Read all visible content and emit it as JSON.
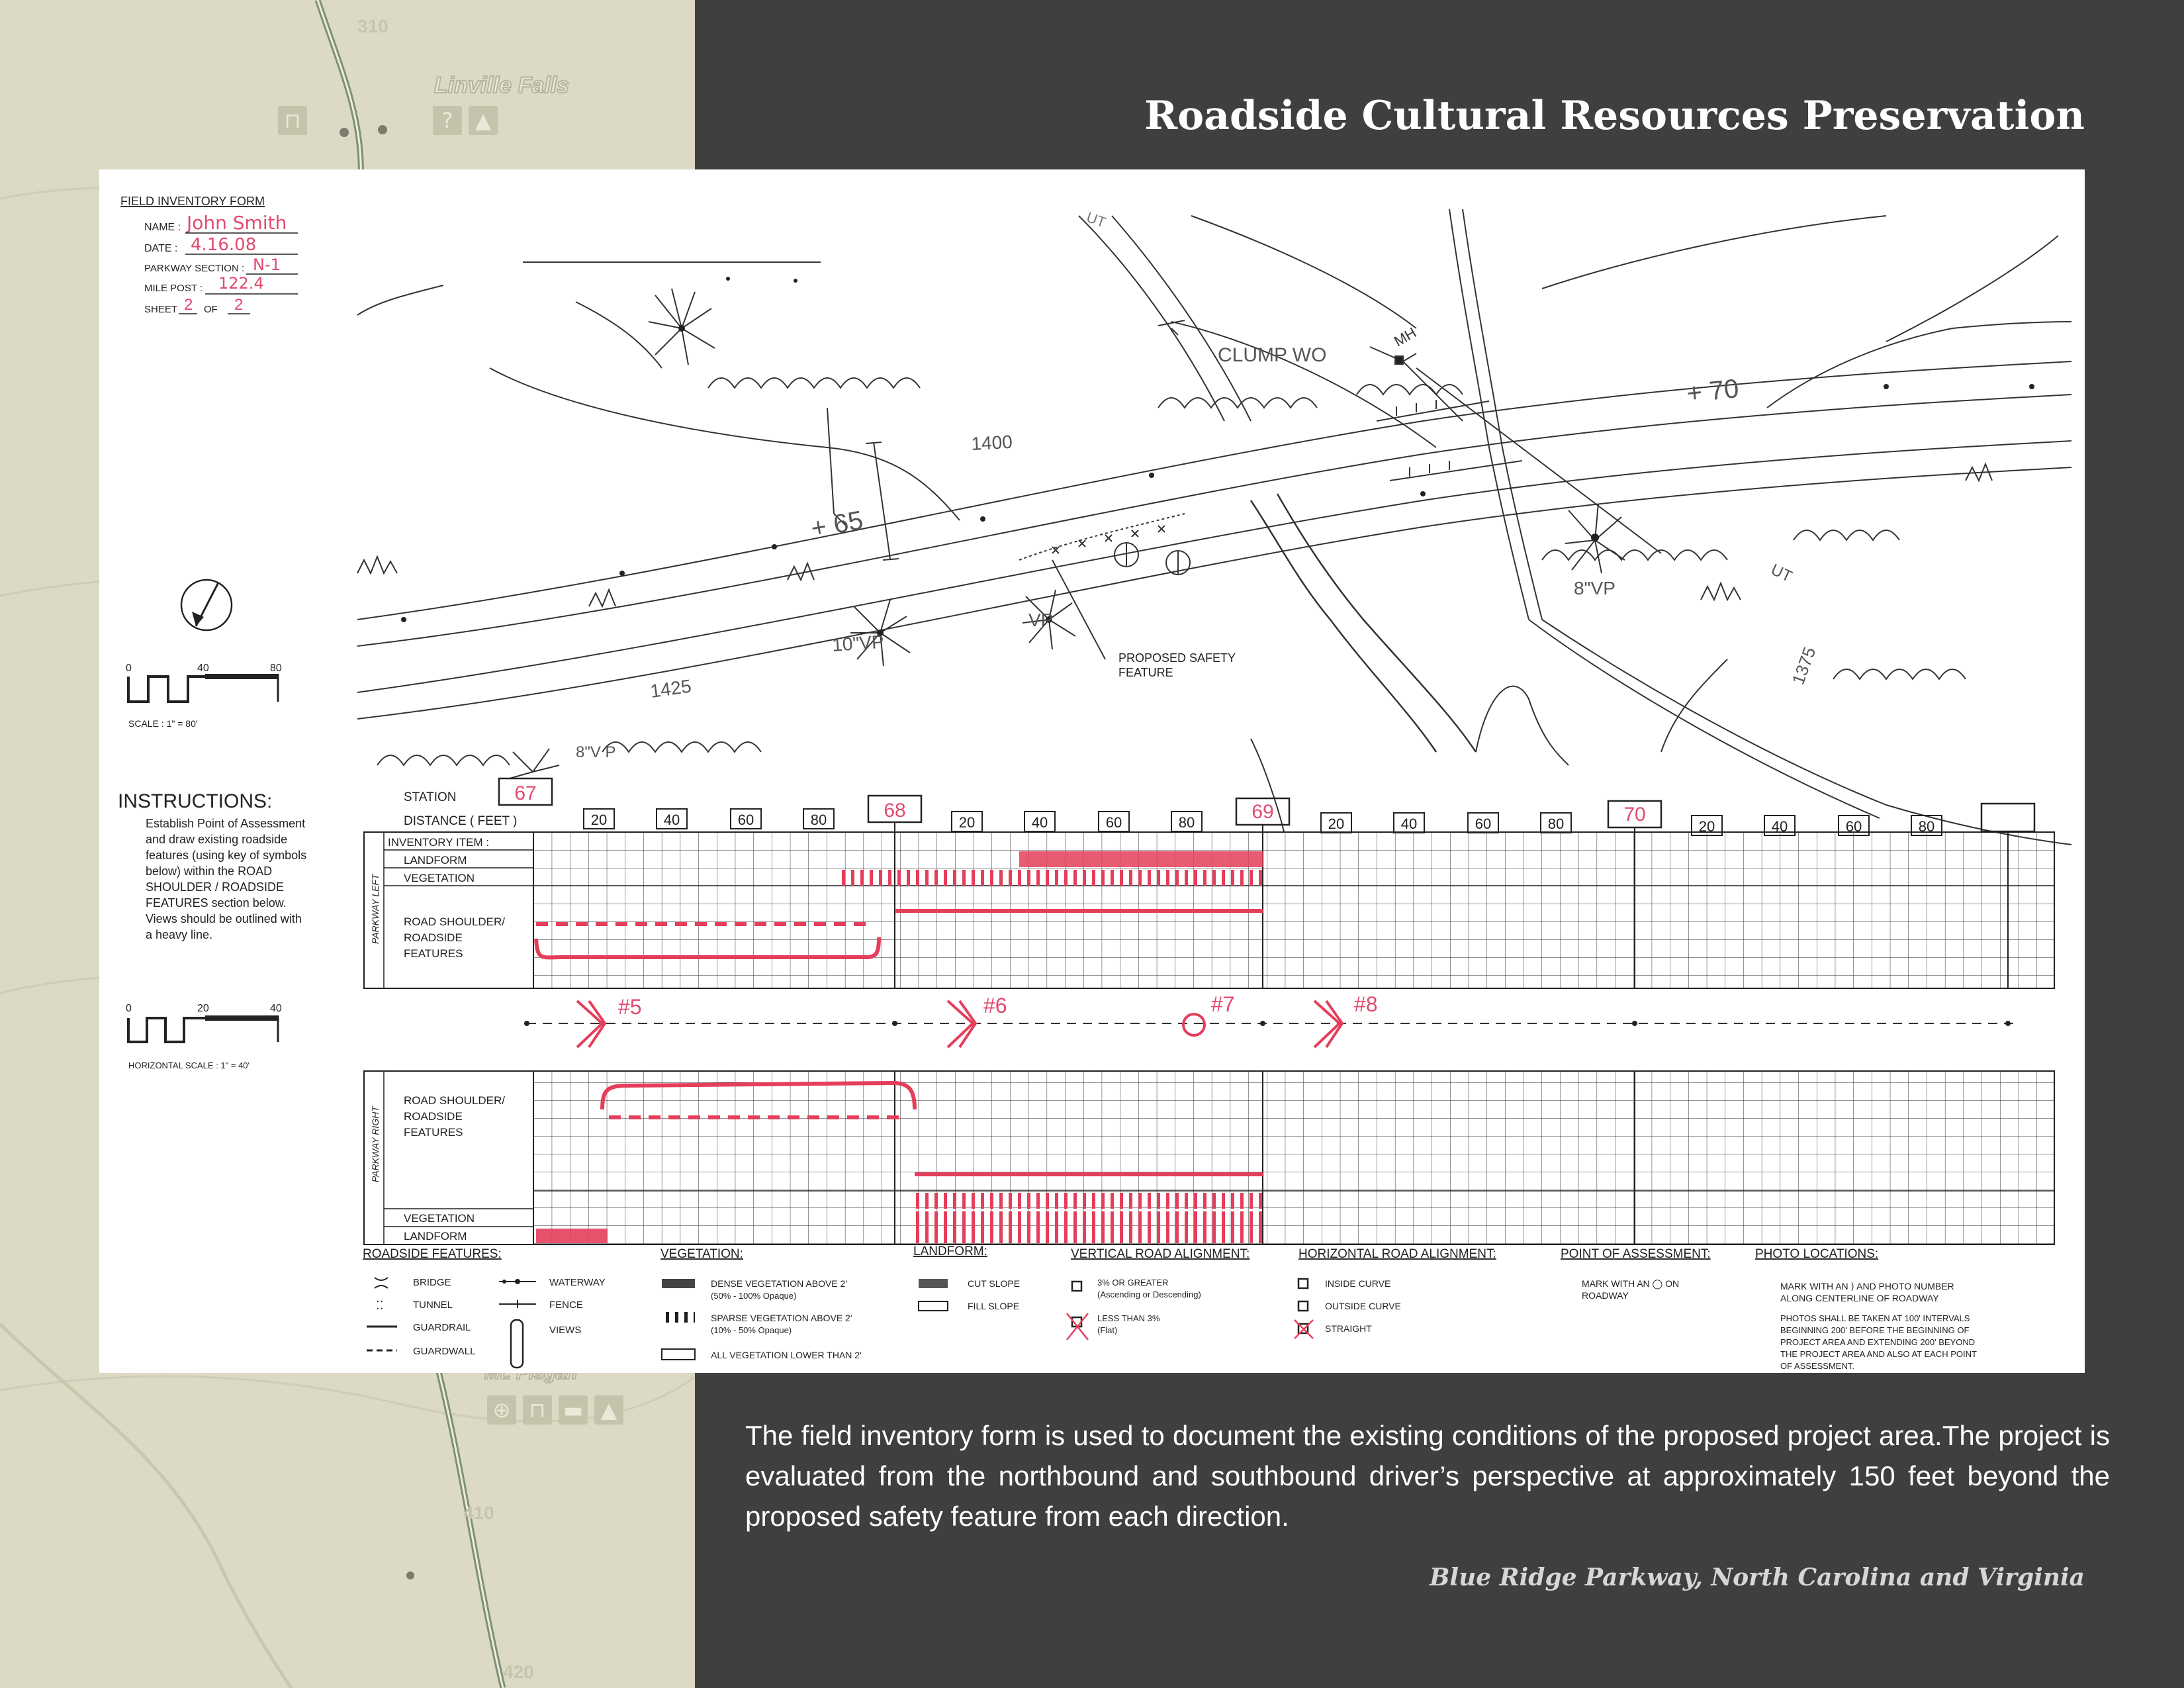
{
  "page_title": "Roadside Cultural Resources Preservation",
  "caption": "The field inventory form is used to document the existing conditions of the proposed project area.The project is evaluated from the northbound and southbound driver’s perspective at approximately 150 feet beyond the proposed safety feature from each direction.",
  "source": "Blue Ridge Parkway, North Carolina and Virginia",
  "map": {
    "route_numbers": [
      "310",
      "410",
      "420"
    ],
    "features": [
      "Linville Falls",
      "Mt. Pisgah"
    ],
    "icons": [
      "picnic-icon",
      "info-icon",
      "camping-icon",
      "food-icon",
      "lodging-icon"
    ]
  },
  "form": {
    "header": {
      "title": "FIELD INVENTORY FORM",
      "name_label": "NAME :",
      "name_value": "John Smith",
      "date_label": "DATE :",
      "date_value": "4.16.08",
      "section_label": "PARKWAY SECTION :",
      "section_value": "N-1",
      "milepost_label": "MILE POST :",
      "milepost_value": "122.4",
      "sheet_label": "SHEET",
      "sheet_value": "2",
      "of_label": "OF",
      "of_value": "2"
    },
    "scale": {
      "ticks": [
        "0",
        "40",
        "80"
      ],
      "label": "SCALE : 1\" = 80'"
    },
    "horizontal_scale": {
      "ticks": [
        "0",
        "20",
        "40"
      ],
      "label": "HORIZONTAL SCALE : 1\" = 40'"
    },
    "plan_labels": {
      "station_65": "+ 65",
      "station_70": "+ 70",
      "contour_1400": "1400",
      "contour_1425": "1425",
      "contour_1375": "1375",
      "clump": "CLUMP WO",
      "mh": "MH",
      "ut_top": "UT",
      "ut_right": "UT",
      "vp_10": "10\"VP",
      "vp": "VP",
      "vp_8": "8\"VP",
      "vp_8_low": "8\"V P",
      "proposed_1": "PROPOSED SAFETY",
      "proposed_2": "FEATURE"
    },
    "instructions": {
      "title": "INSTRUCTIONS:",
      "lines": [
        "Establish Point of Assessment",
        "and draw existing roadside",
        "features (using key of symbols",
        "below) within the ROAD",
        "SHOULDER / ROADSIDE",
        "FEATURES section below.",
        "Views should be outlined with",
        "a heavy line."
      ]
    },
    "grid": {
      "station_label": "STATION",
      "distance_label": "DISTANCE ( FEET )",
      "inventory_label": "INVENTORY ITEM :",
      "stations": [
        "67",
        "68",
        "69",
        "70",
        ""
      ],
      "distances": [
        "20",
        "40",
        "60",
        "80"
      ],
      "left_side_label": "PARKWAY LEFT",
      "right_side_label": "PARKWAY RIGHT",
      "landform": "LANDFORM",
      "vegetation": "VEGETATION",
      "road_shoulder": [
        "ROAD SHOULDER/",
        "ROADSIDE",
        "FEATURES"
      ],
      "photo_points": [
        "#5",
        "#6",
        "#7",
        "#8"
      ]
    },
    "legend": {
      "roadside": {
        "title": "ROADSIDE FEATURES:",
        "items": [
          "BRIDGE",
          "TUNNEL",
          "GUARDRAIL",
          "GUARDWALL",
          "WATERWAY",
          "FENCE",
          "VIEWS"
        ]
      },
      "vegetation": {
        "title": "VEGETATION:",
        "dense_1": "DENSE VEGETATION ABOVE 2'",
        "dense_2": "(50% - 100% Opaque)",
        "sparse_1": "SPARSE VEGETATION ABOVE 2'",
        "sparse_2": "(10% - 50% Opaque)",
        "low": "ALL VEGETATION LOWER THAN 2'"
      },
      "landform": {
        "title": "LANDFORM:",
        "cut": "CUT SLOPE",
        "fill": "FILL SLOPE"
      },
      "vertical": {
        "title": "VERTICAL ROAD ALIGNMENT:",
        "greater_1": "3% OR GREATER",
        "greater_2": "(Ascending or Descending)",
        "less_1": "LESS THAN 3%",
        "less_2": "(Flat)"
      },
      "horizontal": {
        "title": "HORIZONTAL ROAD ALIGNMENT:",
        "inside": "INSIDE CURVE",
        "outside": "OUTSIDE CURVE",
        "straight": "STRAIGHT"
      },
      "assessment": {
        "title": "POINT OF ASSESSMENT:",
        "line_1": "MARK WITH AN ◯ ON",
        "line_2": "ROADWAY"
      },
      "photo": {
        "title": "PHOTO LOCATIONS:",
        "line_1": "MARK WITH AN  ⟩  AND PHOTO NUMBER",
        "line_2": "ALONG CENTERLINE OF ROADWAY",
        "note": [
          "PHOTOS SHALL BE TAKEN AT 100' INTERVALS",
          "BEGINNING 200' BEFORE THE BEGINNING OF",
          "PROJECT AREA AND EXTENDING 200' BEYOND",
          "THE PROJECT AREA AND ALSO AT EACH POINT",
          "OF ASSESSMENT."
        ]
      }
    }
  }
}
